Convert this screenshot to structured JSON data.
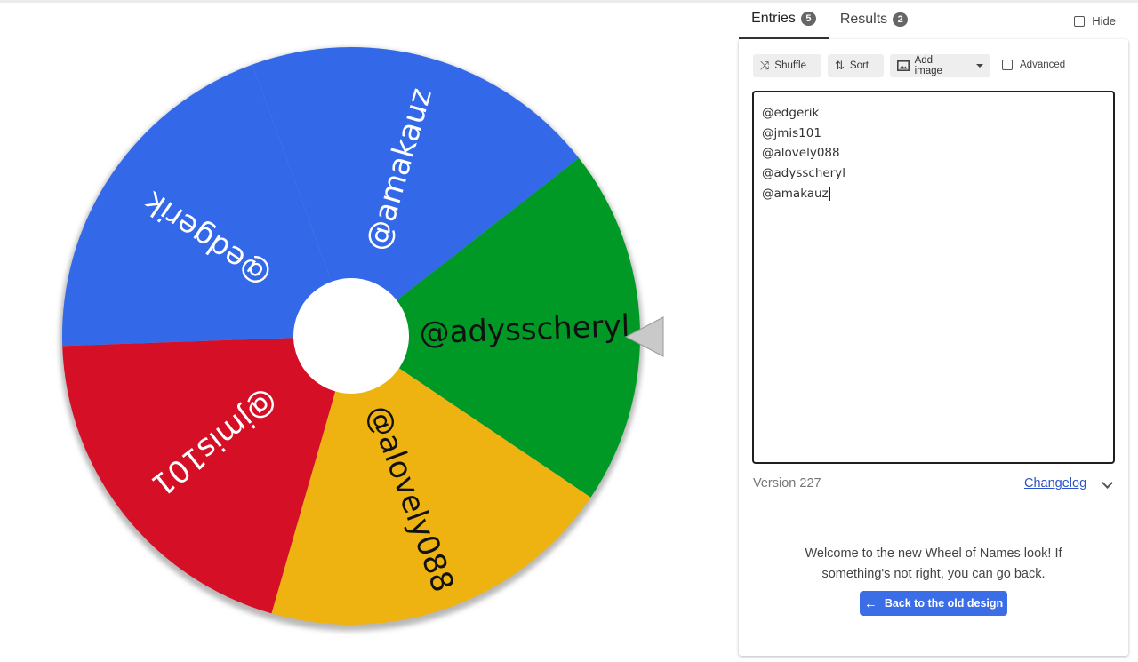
{
  "wheel": {
    "segments": [
      {
        "label": "@edgerik",
        "color": "#3369e8",
        "text_color": "#ffffff"
      },
      {
        "label": "@amakauz",
        "color": "#3369e8",
        "text_color": "#ffffff"
      },
      {
        "label": "@adysscheryl",
        "color": "#009925",
        "text_color": "#111111"
      },
      {
        "label": "@alovely088",
        "color": "#eeb211",
        "text_color": "#111111"
      },
      {
        "label": "@jmis101",
        "color": "#d50f25",
        "text_color": "#ffffff"
      }
    ],
    "pointer_color": "#c9c9c9"
  },
  "tabs": {
    "entries": {
      "label": "Entries",
      "count": "5"
    },
    "results": {
      "label": "Results",
      "count": "2"
    }
  },
  "hide": {
    "label": "Hide"
  },
  "toolbar": {
    "shuffle_label": "Shuffle",
    "sort_label": "Sort",
    "add_image_label": "Add image",
    "advanced_label": "Advanced"
  },
  "entries": [
    "@edgerik",
    "@jmis101",
    "@alovely088",
    "@adysscheryl",
    "@amakauz"
  ],
  "footer": {
    "version": "Version 227",
    "changelog": "Changelog",
    "welcome": "Welcome to the new Wheel of Names look! If something's not right, you can go back.",
    "back_button": "Back to the old design"
  },
  "colors": {
    "accent": "#3b6ee6",
    "link": "#2a53c7"
  }
}
